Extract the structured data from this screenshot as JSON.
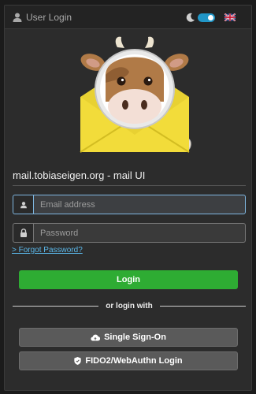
{
  "header": {
    "title": "User Login",
    "theme_toggle_on": true,
    "language": "English (UK)"
  },
  "logo": {
    "name": "mailcow cow logo"
  },
  "login_form": {
    "domain_title": "mail.tobiaseigen.org - mail UI",
    "email_placeholder": "Email address",
    "email_value": "",
    "password_placeholder": "Password",
    "password_value": "",
    "forgot_password": "> Forgot Password?",
    "login_button": "Login"
  },
  "alt_login": {
    "separator": "or login with",
    "sso_button": "Single Sign-On",
    "fido_button": "FIDO2/WebAuthn Login"
  },
  "colors": {
    "accent": "#2196c7",
    "login_green": "#2eac33",
    "link": "#5bb8ea",
    "panel": "#2c2c2c"
  }
}
